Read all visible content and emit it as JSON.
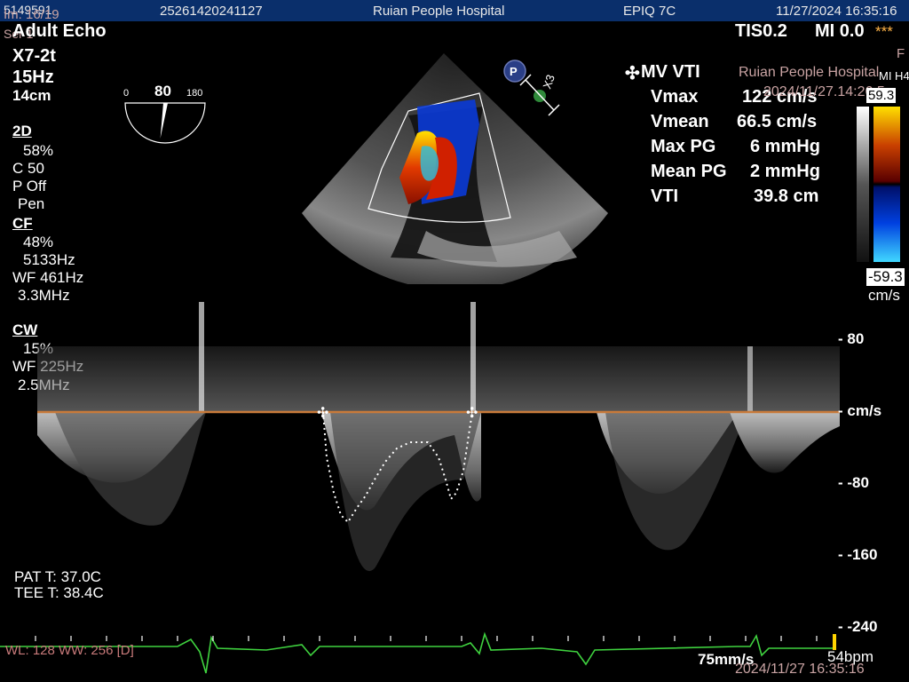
{
  "header": {
    "patient_id": "5149591",
    "image_counter": "Im: 16/19",
    "series": "Ser 1",
    "exam_id": "25261420241127",
    "hospital": "Ruian People Hospital",
    "system": "EPIQ 7C",
    "datetime": "11/27/2024 16:35:16"
  },
  "preset": "Adult Echo",
  "probe": "X7-2t",
  "frame_rate": "15Hz",
  "depth": "14cm",
  "tis": "TIS0.2",
  "mi": "MI 0.0",
  "mi_stars": "***",
  "f_label": "F",
  "omniplane": {
    "min": "0",
    "angle": "80",
    "max": "180",
    "angle_value": 80
  },
  "markers": {
    "p_icon": "P",
    "x3": "X3"
  },
  "hospital_overlay": "Ruian People Hospital",
  "overlay_stamp": "2024/11/27.14:26:5",
  "params_2d": {
    "title": "2D",
    "gain": "58%",
    "comp": "C 50",
    "persist": "P Off",
    "mode": "Pen"
  },
  "params_cf": {
    "title": "CF",
    "gain": "48%",
    "prf": "5133Hz",
    "wf": "WF 461Hz",
    "freq": "3.3MHz"
  },
  "params_cw": {
    "title": "CW",
    "gain": "15%",
    "wf": "WF 225Hz",
    "freq": "2.5MHz"
  },
  "measurement": {
    "title": "MV VTI",
    "rows": [
      {
        "label": "Vmax",
        "value": "122 cm/s"
      },
      {
        "label": "Vmean",
        "value": "66.5 cm/s"
      },
      {
        "label": "Max PG",
        "value": "6 mmHg"
      },
      {
        "label": "Mean PG",
        "value": "2 mmHg"
      },
      {
        "label": "VTI",
        "value": "39.8 cm"
      }
    ]
  },
  "color_bar": {
    "top": "59.3",
    "bottom": "-59.3",
    "unit": "cm/s",
    "label_top": "MI H4"
  },
  "doppler_scale": {
    "ticks": [
      "80",
      "cm/s",
      "-80",
      "-160",
      "-240"
    ]
  },
  "temps": {
    "pat": "PAT T: 37.0C",
    "tee": "TEE T: 38.4C"
  },
  "footer": {
    "wl_ww": "WL: 128 WW: 256 [D]",
    "sweep": "75mm/s",
    "hr": "54bpm",
    "datetime": "2024/11/27 16:35:16"
  },
  "colors": {
    "baseline": "#c87a3a",
    "ecg": "#3fd23f",
    "header_bg": "#0a2f6b",
    "overlay_text": "#c9a3a3"
  }
}
